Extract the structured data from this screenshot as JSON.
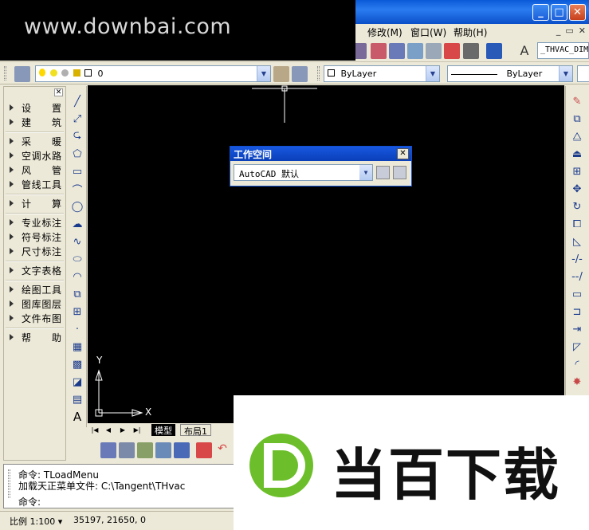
{
  "watermark": {
    "top_text": "www.downbai.com",
    "big_text": "当百下载"
  },
  "window": {
    "min": "_",
    "max": "□",
    "close": "✕"
  },
  "menu": {
    "items": [
      "修改(M)",
      "窗口(W)",
      "帮助(H)"
    ],
    "mdi": [
      "_",
      "▭",
      "✕"
    ]
  },
  "toolbar1": {
    "text_style": "_THVAC_DIM"
  },
  "toolbar2": {
    "layer": "0",
    "color": "ByLayer",
    "linetype": "ByLayer"
  },
  "left_panel": {
    "close": "✕",
    "items": [
      "设置",
      "建筑",
      "采暖",
      "空调水路",
      "风管",
      "管线工具",
      "计算",
      "专业标注",
      "符号标注",
      "尺寸标注",
      "文字表格",
      "绘图工具",
      "图库图层",
      "文件布图",
      "帮助"
    ]
  },
  "ucs": {
    "y": "Y",
    "x": "X"
  },
  "workspace": {
    "title": "工作空间",
    "close": "✕",
    "value": "AutoCAD 默认"
  },
  "tabs": {
    "model": "模型",
    "layout": "布局1"
  },
  "command": {
    "line1": "命令: TLoadMenu",
    "line2": "加载天正菜单文件: C:\\Tangent\\THvac",
    "line3": "命令:"
  },
  "status": {
    "scale": "比例 1:100 ▾",
    "coords": "35197, 21650, 0"
  }
}
